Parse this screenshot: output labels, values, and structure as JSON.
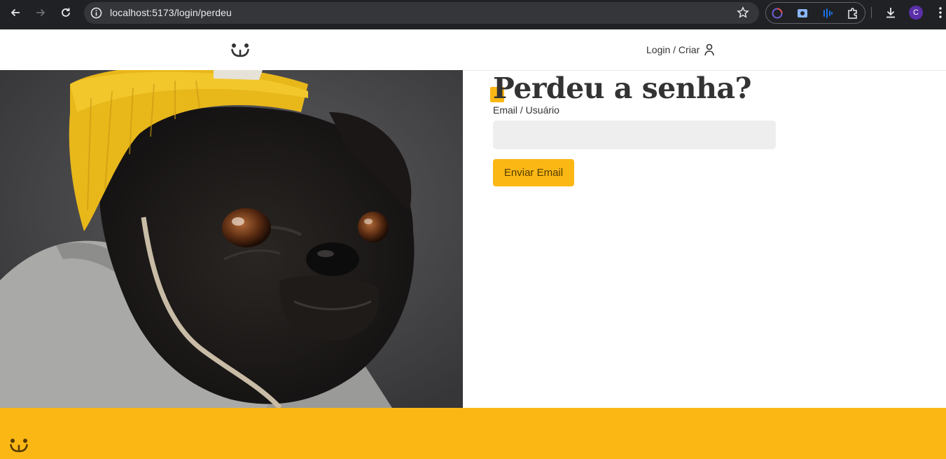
{
  "browser": {
    "url": "localhost:5173/login/perdeu",
    "profile_initial": "C"
  },
  "header": {
    "login_label": "Login / Criar"
  },
  "form": {
    "title": "Perdeu a senha?",
    "email_label": "Email / Usuário",
    "email_value": "",
    "submit_label": "Enviar Email"
  },
  "colors": {
    "accent": "#fbb714",
    "text": "#333333",
    "input_bg": "#eeeeee"
  },
  "icons": {
    "logo": "dog-face-icon",
    "login": "user-icon"
  }
}
